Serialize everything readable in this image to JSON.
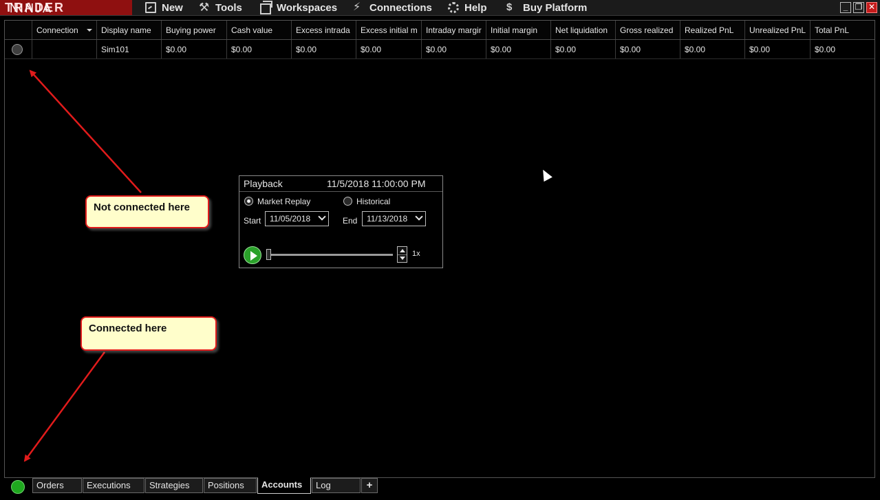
{
  "app": {
    "logo_left": "NINJA",
    "logo_right": "TRADER"
  },
  "menu": [
    {
      "label": "New",
      "icon": "new-window-icon"
    },
    {
      "label": "Tools",
      "icon": "tools-icon"
    },
    {
      "label": "Workspaces",
      "icon": "workspaces-icon"
    },
    {
      "label": "Connections",
      "icon": "plug-icon"
    },
    {
      "label": "Help",
      "icon": "help-icon"
    },
    {
      "label": "Buy Platform",
      "icon": "dollar-icon"
    }
  ],
  "window_controls": {
    "minimize": "_",
    "restore": "❐",
    "close": "✕"
  },
  "grid": {
    "columns": [
      "",
      "Connection",
      "Display name",
      "Buying power",
      "Cash value",
      "Excess intrada",
      "Excess initial m",
      "Intraday margir",
      "Initial margin",
      "Net liquidation",
      "Gross realized",
      "Realized PnL",
      "Unrealized PnL",
      "Total PnL"
    ],
    "rows": [
      {
        "connection": "",
        "display_name": "Sim101",
        "buying_power": "$0.00",
        "cash_value": "$0.00",
        "excess_intraday": "$0.00",
        "excess_initial": "$0.00",
        "intraday_margin": "$0.00",
        "initial_margin": "$0.00",
        "net_liquidation": "$0.00",
        "gross_realized": "$0.00",
        "realized_pnl": "$0.00",
        "unrealized_pnl": "$0.00",
        "total_pnl": "$0.00"
      }
    ]
  },
  "playback": {
    "title": "Playback",
    "datetime": "11/5/2018 11:00:00 PM",
    "mode_market_replay": "Market Replay",
    "mode_historical": "Historical",
    "selected_mode": "Market Replay",
    "start_label": "Start",
    "start_value": "11/05/2018",
    "end_label": "End",
    "end_value": "11/13/2018",
    "speed": "1x",
    "progress": 0
  },
  "callouts": {
    "not_connected": "Not connected here",
    "connected": "Connected here"
  },
  "colors": {
    "annotation_border": "#e11b1b",
    "annotation_fill": "#fffecb",
    "connected": "#1fa81f",
    "logo_bg": "#8f1010"
  },
  "tabs": {
    "items": [
      "Orders",
      "Executions",
      "Strategies",
      "Positions",
      "Accounts",
      "Log"
    ],
    "active": "Accounts",
    "add_label": "+"
  }
}
